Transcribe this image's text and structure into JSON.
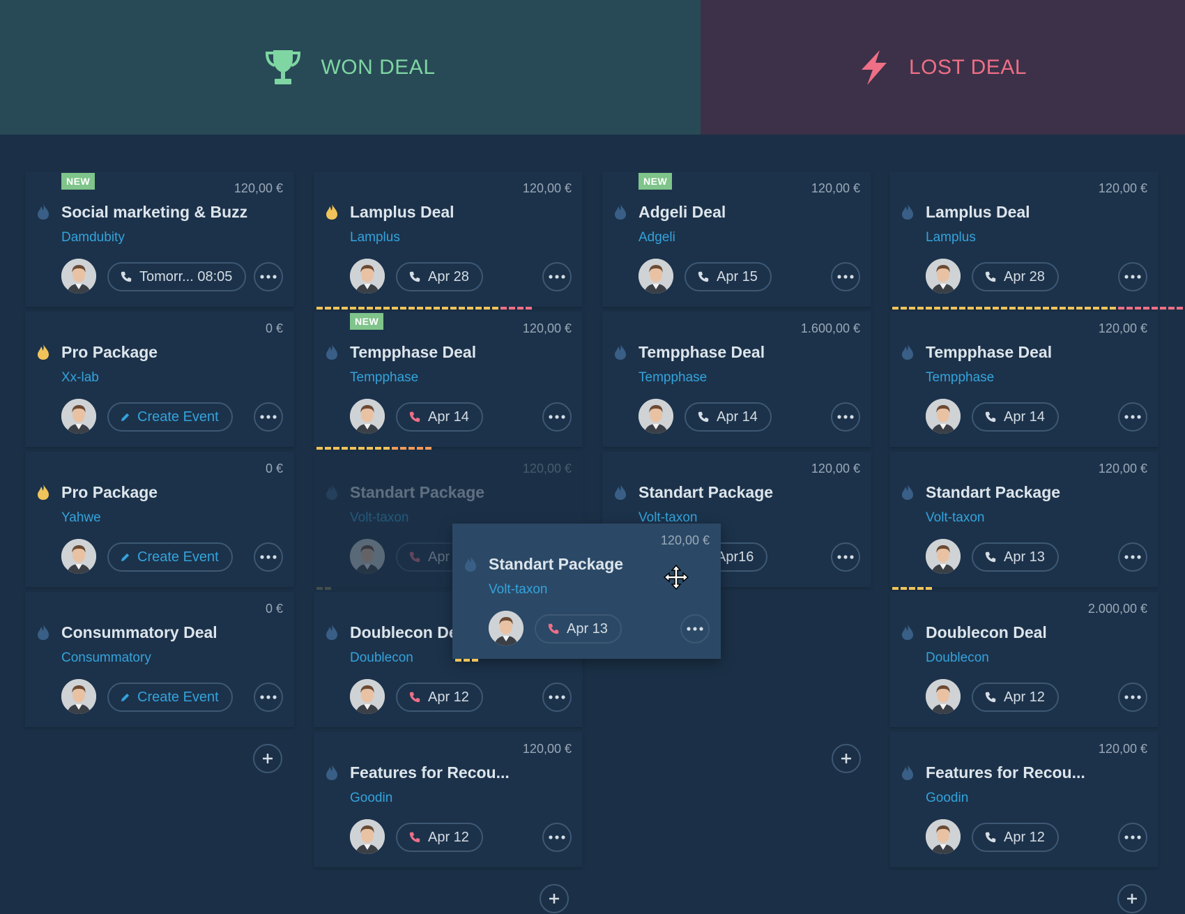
{
  "dropzones": {
    "won": {
      "label": "WON DEAL",
      "color": "#7fd6a3",
      "icon": "trophy-icon"
    },
    "lost": {
      "label": "LOST DEAL",
      "color": "#ee6f86",
      "icon": "lightning-icon"
    }
  },
  "colors": {
    "accent": "#34a3dc",
    "flame_hot": "#f0c45a",
    "flame_cold": "#3a5f86",
    "new_badge": "#7fc48a"
  },
  "columns": [
    {
      "cards": [
        {
          "badge": "NEW",
          "amount": "120,00 €",
          "title": "Social marketing & Buzz",
          "company": "Damdubity",
          "action": "Tomorr... 08:05",
          "action_type": "call",
          "flame": "cold"
        },
        {
          "amount": "0 €",
          "title": "Pro Package",
          "company": "Xx-lab",
          "action": "Create Event",
          "action_type": "create",
          "flame": "hot"
        },
        {
          "amount": "0 €",
          "title": "Pro Package",
          "company": "Yahwe",
          "action": "Create Event",
          "action_type": "create",
          "flame": "hot"
        },
        {
          "amount": "0 €",
          "title": "Consummatory Deal",
          "company": "Consummatory",
          "action": "Create Event",
          "action_type": "create",
          "flame": "cold"
        }
      ]
    },
    {
      "cards": [
        {
          "amount": "120,00 €",
          "title": "Lamplus Deal",
          "company": "Lamplus",
          "action": "Apr 28",
          "action_type": "call",
          "flame": "hot"
        },
        {
          "badge": "NEW",
          "amount": "120,00 €",
          "title": "Tempphase Deal",
          "company": "Tempphase",
          "action": "Apr 14",
          "action_type": "call-red",
          "flame": "cold"
        },
        {
          "amount": "120,00 €",
          "title": "Standart Package",
          "company": "Volt-taxon",
          "action": "Apr",
          "action_type": "call-red",
          "flame": "cold",
          "ghost": true
        },
        {
          "amount": "",
          "title": "Doublecon De",
          "company": "Doublecon",
          "action": "Apr 12",
          "action_type": "call-red",
          "flame": "cold"
        },
        {
          "amount": "120,00 €",
          "title": "Features for Recou...",
          "company": "Goodin",
          "action": "Apr 12",
          "action_type": "call-red",
          "flame": "cold"
        }
      ]
    },
    {
      "cards": [
        {
          "badge": "NEW",
          "amount": "120,00 €",
          "title": "Adgeli Deal",
          "company": "Adgeli",
          "action": "Apr 15",
          "action_type": "call",
          "flame": "cold"
        },
        {
          "amount": "1.600,00 €",
          "title": "Tempphase Deal",
          "company": "Tempphase",
          "action": "Apr 14",
          "action_type": "call",
          "flame": "cold"
        },
        {
          "amount": "120,00 €",
          "title": "Standart Package",
          "company": "Volt-taxon",
          "action": "Apr16",
          "action_type": "call",
          "flame": "cold"
        }
      ]
    },
    {
      "cards": [
        {
          "amount": "120,00 €",
          "title": "Lamplus Deal",
          "company": "Lamplus",
          "action": "Apr 28",
          "action_type": "call",
          "flame": "cold"
        },
        {
          "amount": "120,00 €",
          "title": "Tempphase Deal",
          "company": "Tempphase",
          "action": "Apr 14",
          "action_type": "call",
          "flame": "cold"
        },
        {
          "amount": "120,00 €",
          "title": "Standart Package",
          "company": "Volt-taxon",
          "action": "Apr 13",
          "action_type": "call",
          "flame": "cold"
        },
        {
          "amount": "2.000,00 €",
          "title": "Doublecon Deal",
          "company": "Doublecon",
          "action": "Apr 12",
          "action_type": "call",
          "flame": "cold"
        },
        {
          "amount": "120,00 €",
          "title": "Features for Recou...",
          "company": "Goodin",
          "action": "Apr 12",
          "action_type": "call",
          "flame": "cold"
        }
      ]
    }
  ],
  "dragged_card": {
    "amount": "120,00 €",
    "title": "Standart Package",
    "company": "Volt-taxon",
    "action": "Apr 13",
    "action_type": "call-red",
    "flame": "cold"
  }
}
